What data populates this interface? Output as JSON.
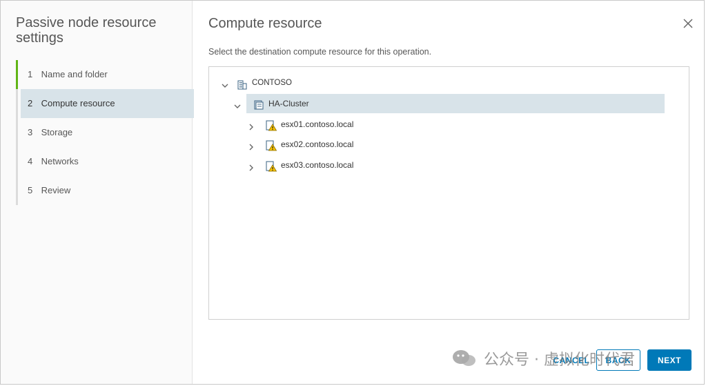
{
  "wizard": {
    "title": "Passive node resource settings",
    "steps": [
      {
        "num": "1",
        "label": "Name and folder",
        "state": "done"
      },
      {
        "num": "2",
        "label": "Compute resource",
        "state": "active"
      },
      {
        "num": "3",
        "label": "Storage",
        "state": "pending"
      },
      {
        "num": "4",
        "label": "Networks",
        "state": "pending"
      },
      {
        "num": "5",
        "label": "Review",
        "state": "pending"
      }
    ]
  },
  "main": {
    "title": "Compute resource",
    "subtitle": "Select the destination compute resource for this operation."
  },
  "tree": {
    "datacenter": {
      "label": "CONTOSO",
      "icon": "datacenter-icon",
      "expanded": true
    },
    "cluster": {
      "label": "HA-Cluster",
      "icon": "cluster-icon",
      "expanded": true,
      "selected": true
    },
    "hosts": [
      {
        "label": "esx01.contoso.local",
        "icon": "host-warning-icon",
        "expanded": false
      },
      {
        "label": "esx02.contoso.local",
        "icon": "host-warning-icon",
        "expanded": false
      },
      {
        "label": "esx03.contoso.local",
        "icon": "host-warning-icon",
        "expanded": false
      }
    ]
  },
  "footer": {
    "cancel_label": "CANCEL",
    "back_label": "BACK",
    "next_label": "NEXT"
  },
  "watermark": {
    "text": "公众号 · 虚拟化时代君"
  },
  "colors": {
    "accent": "#0079b8",
    "selected_bg": "#d8e3e9",
    "done_step": "#60b515",
    "warning": "#f8c400"
  }
}
